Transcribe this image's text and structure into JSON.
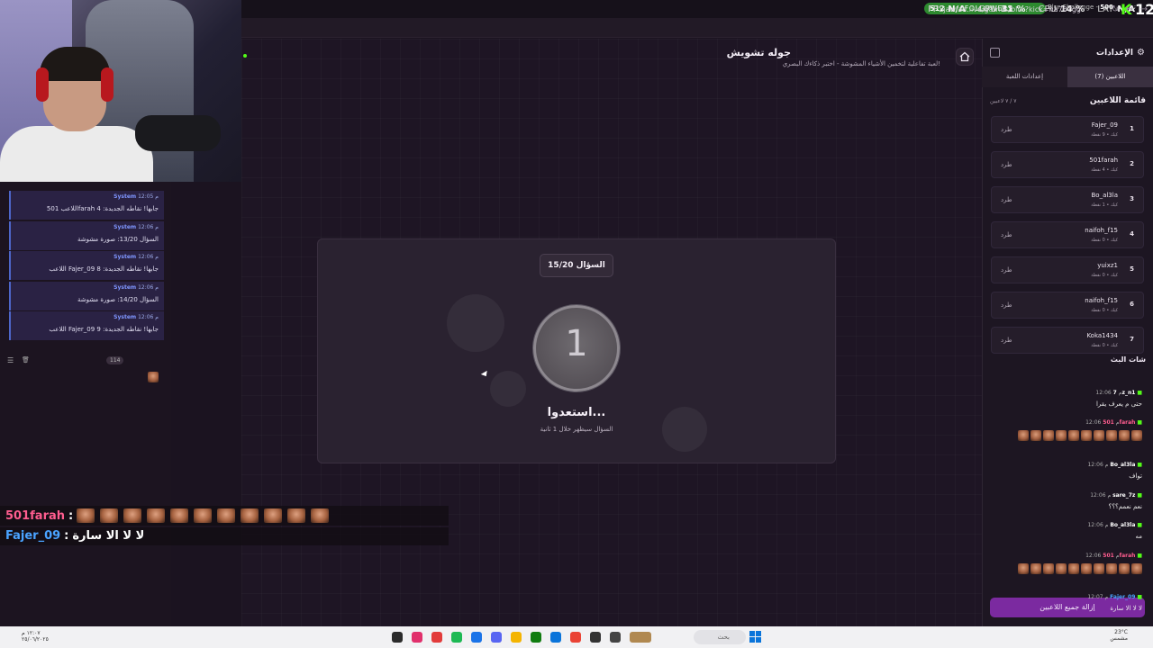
{
  "overlay_stats": {
    "fps_label": "FPS",
    "fps": "N/A",
    "gpu_label": "GPU",
    "gpu": "31 %",
    "cpu_label": "CPU",
    "cpu": "14 %",
    "lat_label": "LAT",
    "lat": "N/A",
    "followers_label": "FOLLOWERS",
    "followers_count": "512",
    "challenge": "Blur Challenge - تشويش",
    "challenge_count": "500",
    "kick_count": "12"
  },
  "browser": {
    "url": "jawlah.live/games/blur?kick=na707gg"
  },
  "game": {
    "title": "جوله تشويش",
    "subtitle": "لعبة تفاعلية لتخمين الأشياء المشوشة - اختبر ذكاءك البصري!",
    "question_badge": "السؤال 15/20",
    "countdown": "1",
    "ready_text": "استعدوا...",
    "ready_sub": "السؤال سيظهر خلال 1 ثانية"
  },
  "panel": {
    "title": "الإعدادات",
    "tab_players": "اللاعبين (7)",
    "tab_settings": "إعدادات اللعبة",
    "list_title": "قائمة اللاعبين",
    "list_count": "٧ / ٧ لاعبين",
    "kick_label": "طرد",
    "remove_all": "إزالة جميع اللاعبين",
    "players": [
      {
        "idx": "1",
        "name": "Fajer_09",
        "pts": "كيك • 9 نقطة"
      },
      {
        "idx": "2",
        "name": "501farah",
        "pts": "كيك • 4 نقطة"
      },
      {
        "idx": "3",
        "name": "Bo_al3la",
        "pts": "كيك • 1 نقطة"
      },
      {
        "idx": "4",
        "name": "naifoh_f15",
        "pts": "كيك • 0 نقطة"
      },
      {
        "idx": "5",
        "name": "yuixz1",
        "pts": "كيك • 0 نقطة"
      },
      {
        "idx": "6",
        "name": "naifoh_f15",
        "pts": "كيك • 0 نقطة"
      },
      {
        "idx": "7",
        "name": "Koka1434",
        "pts": "كيك • 0 نقطة"
      }
    ]
  },
  "chat": {
    "system_messages": [
      {
        "sender": "System",
        "time": "12:05 م",
        "text": "اللاعب 501farah جابها! نقاطه الجديدة: 4"
      },
      {
        "sender": "System",
        "time": "12:06 م",
        "text": "السؤال 13/20: صورة مشوشة"
      },
      {
        "sender": "System",
        "time": "12:06 م",
        "text": "اللاعب Fajer_09 جابها! نقاطه الجديدة: 8"
      },
      {
        "sender": "System",
        "time": "12:06 م",
        "text": "السؤال 14/20: صورة مشوشة"
      },
      {
        "sender": "System",
        "time": "12:06 م",
        "text": "اللاعب Fajer_09 جابها! نقاطه الجديدة: 9"
      }
    ],
    "title": "شات البث",
    "count": "114",
    "messages": [
      {
        "user": "7z_n1",
        "time": "12:06 م",
        "text": "حتى م يعرف يقرا",
        "color": "#ffffff"
      },
      {
        "user": "501farah",
        "time": "12:06 م",
        "text": "",
        "color": "#ff5d8f"
      },
      {
        "user": "Bo_al3la",
        "time": "12:06 م",
        "text": "تواف",
        "color": "#ffffff"
      },
      {
        "user": "sare_7z",
        "time": "12:06 م",
        "text": "نعم نعمم؟؟؟",
        "color": "#ffffff"
      },
      {
        "user": "Bo_al3la",
        "time": "12:06 م",
        "text": "مه",
        "color": "#ffffff"
      },
      {
        "user": "501farah",
        "time": "12:06 م",
        "text": "",
        "color": "#ff5d8f"
      },
      {
        "user": "Fajer_09",
        "time": "12:07 م",
        "text": "لا لا الا سارة",
        "color": "#4aa3ff"
      }
    ]
  },
  "overlay_chat": [
    {
      "user": "501farah",
      "text": "",
      "color": "#ff5d8f"
    },
    {
      "user": "Fajer_09",
      "text": "لا لا الا سارة",
      "color": "#4aa3ff"
    }
  ],
  "taskbar": {
    "search_placeholder": "بحث",
    "weather": "23°C",
    "weather_sub": "مشمس",
    "clock": "١٢:٠٧ م",
    "date": "٢٥/٠٦/٢٠٢٥"
  },
  "colors": {
    "accent_purple": "#7b2aa0",
    "kick_green": "#53fc18",
    "system_blue": "#4d66c9"
  }
}
